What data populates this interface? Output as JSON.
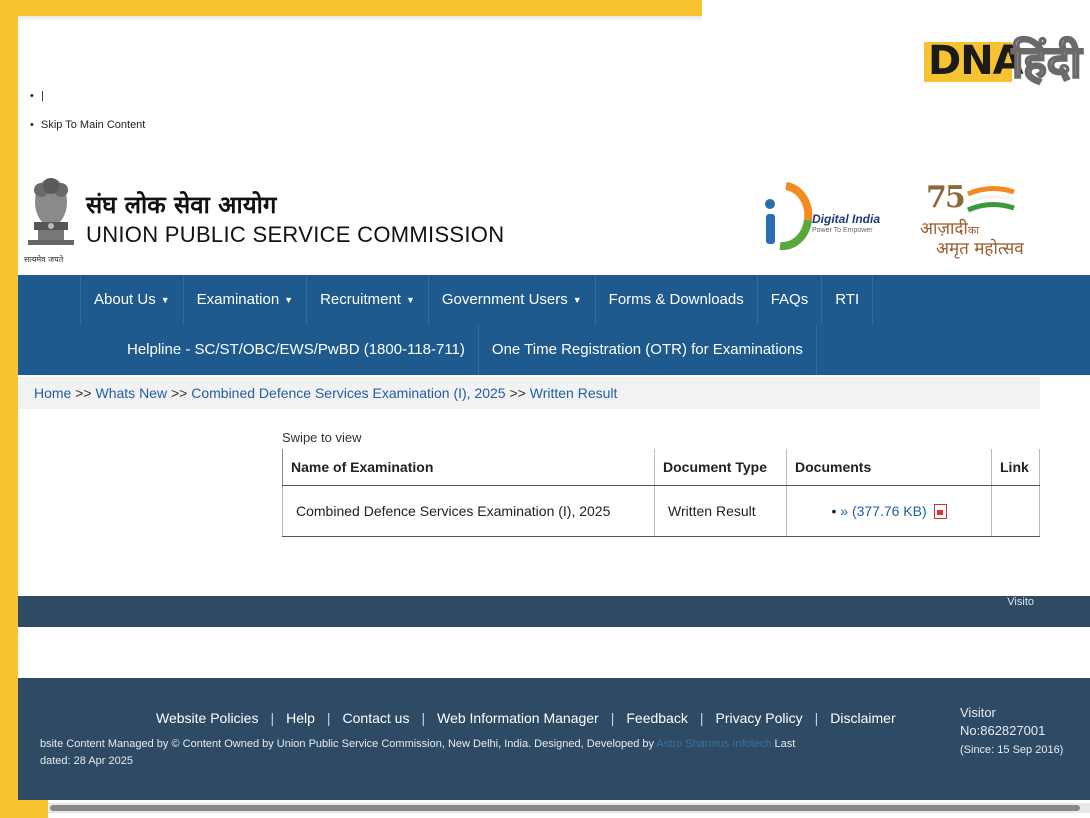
{
  "watermark": {
    "brand": "DNA",
    "brand_hindi": "हिंदी"
  },
  "skip_links": [
    "|",
    "Skip To Main Content"
  ],
  "header": {
    "emblem_caption": "सत्यमेव जयते",
    "org_name_hindi": "संघ लोक सेवा आयोग",
    "org_name_english": "UNION PUBLIC SERVICE COMMISSION",
    "digital_india": {
      "title": "Digital India",
      "tagline": "Power To Empower"
    },
    "azadi": {
      "number": "75",
      "line1": "आज़ादी",
      "ka": "का",
      "line2": "अमृत महोत्सव"
    }
  },
  "nav": {
    "items": [
      {
        "label": "About Us",
        "dropdown": true
      },
      {
        "label": "Examination",
        "dropdown": true
      },
      {
        "label": "Recruitment",
        "dropdown": true
      },
      {
        "label": "Government Users",
        "dropdown": true
      },
      {
        "label": "Forms & Downloads",
        "dropdown": false
      },
      {
        "label": "FAQs",
        "dropdown": false
      },
      {
        "label": "RTI",
        "dropdown": false
      }
    ],
    "row2": [
      "Helpline - SC/ST/OBC/EWS/PwBD (1800-118-711)",
      "One Time Registration (OTR) for Examinations"
    ]
  },
  "breadcrumb": {
    "items": [
      "Home",
      "Whats New",
      "Combined Defence Services Examination (I), 2025",
      "Written Result"
    ],
    "separator": ">>"
  },
  "table": {
    "swipe_hint": "Swipe to view",
    "headers": [
      "Name of Examination",
      "Document Type",
      "Documents",
      "Link"
    ],
    "rows": [
      {
        "name": "Combined Defence Services Examination (I), 2025",
        "type": "Written Result",
        "doc_bullet": "•",
        "doc_arrow": "»",
        "doc_size": "(377.76 KB)",
        "link": ""
      }
    ]
  },
  "band": {
    "visitors_label_cut": "Visito"
  },
  "footer": {
    "links": [
      "Website Policies",
      "Help",
      "Contact us",
      "Web Information Manager",
      "Feedback",
      "Privacy Policy",
      "Disclaimer"
    ],
    "content_line_prefix": "bsite Content Managed by © Content Owned by Union Public Service Commission, New Delhi, India. Designed, Developed by",
    "developer": "Astro Sharmus Infotech",
    "content_line_suffix": "Last",
    "updated_line": "dated: 28 Apr 2025",
    "visitor_label": "Visitor",
    "visitor_no": "No:862827001",
    "visitor_since": "(Since: 15 Sep 2016)"
  },
  "colors": {
    "nav_bg": "#1f5a8e",
    "footer_bg": "#2e4a64",
    "frame": "#f7c331",
    "link": "#1f5fa5"
  }
}
